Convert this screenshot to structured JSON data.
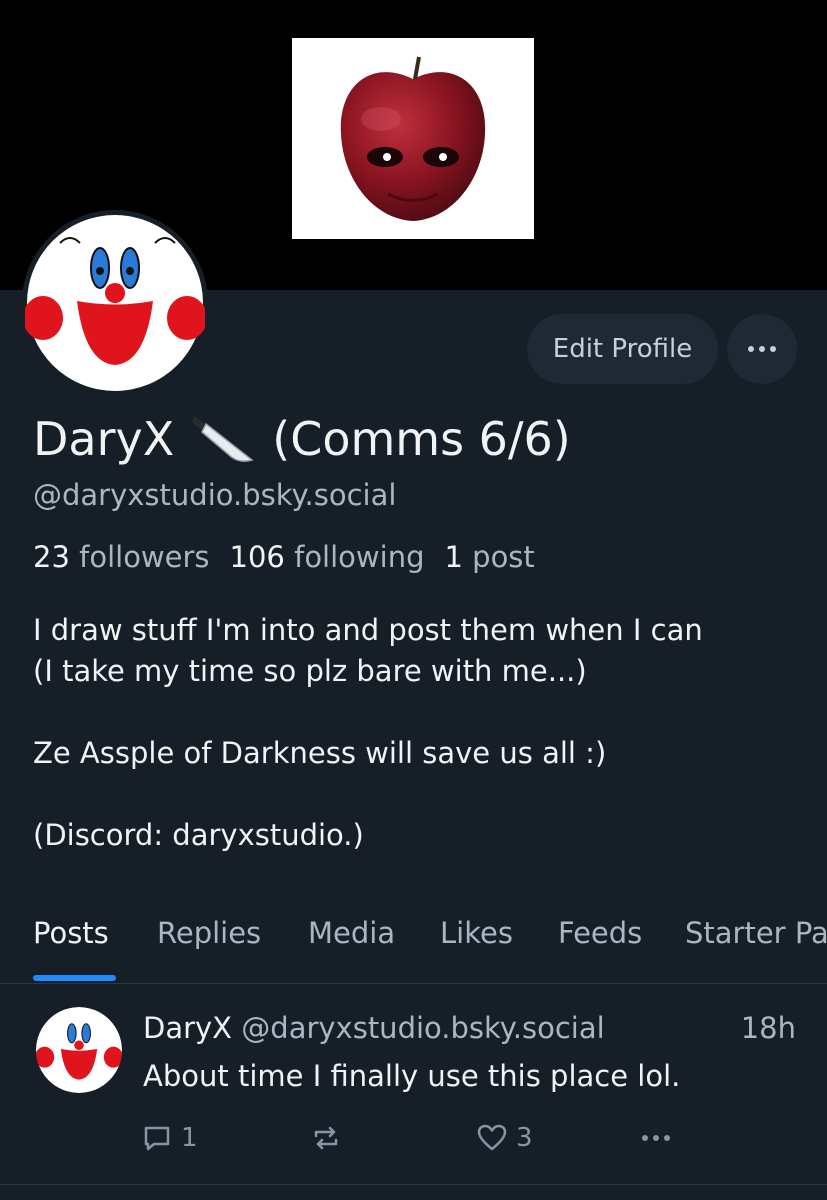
{
  "profile": {
    "display_name": "DaryX",
    "display_name_suffix": "(Comms 6/6)",
    "handle": "@daryxstudio.bsky.social",
    "stats": {
      "followers_count": "23",
      "followers_label": "followers",
      "following_count": "106",
      "following_label": "following",
      "posts_count": "1",
      "posts_label": "post"
    },
    "bio": {
      "line1": "I draw stuff I'm into and post them when I can",
      "line2": "(I take my time so plz bare with me...)",
      "line3": "Ze Assple of Darkness will save us all :)",
      "line4": "(Discord: daryxstudio.)"
    }
  },
  "actions": {
    "edit_profile_label": "Edit Profile",
    "more_icon": "more-horizontal-icon"
  },
  "tabs": [
    {
      "label": "Posts",
      "active": true
    },
    {
      "label": "Replies",
      "active": false
    },
    {
      "label": "Media",
      "active": false
    },
    {
      "label": "Likes",
      "active": false
    },
    {
      "label": "Feeds",
      "active": false
    },
    {
      "label": "Starter Pa",
      "active": false
    }
  ],
  "post": {
    "author": "DaryX",
    "handle": "@daryxstudio.bsky.social",
    "time": "18h",
    "text": "About time I finally use this place lol.",
    "reply_count": "1",
    "repost_count": "",
    "like_count": "3"
  },
  "colors": {
    "background": "#161e27",
    "banner": "#000000",
    "accent": "#208bfe",
    "button_bg": "#1e2935",
    "muted_text": "#aab6c3"
  }
}
